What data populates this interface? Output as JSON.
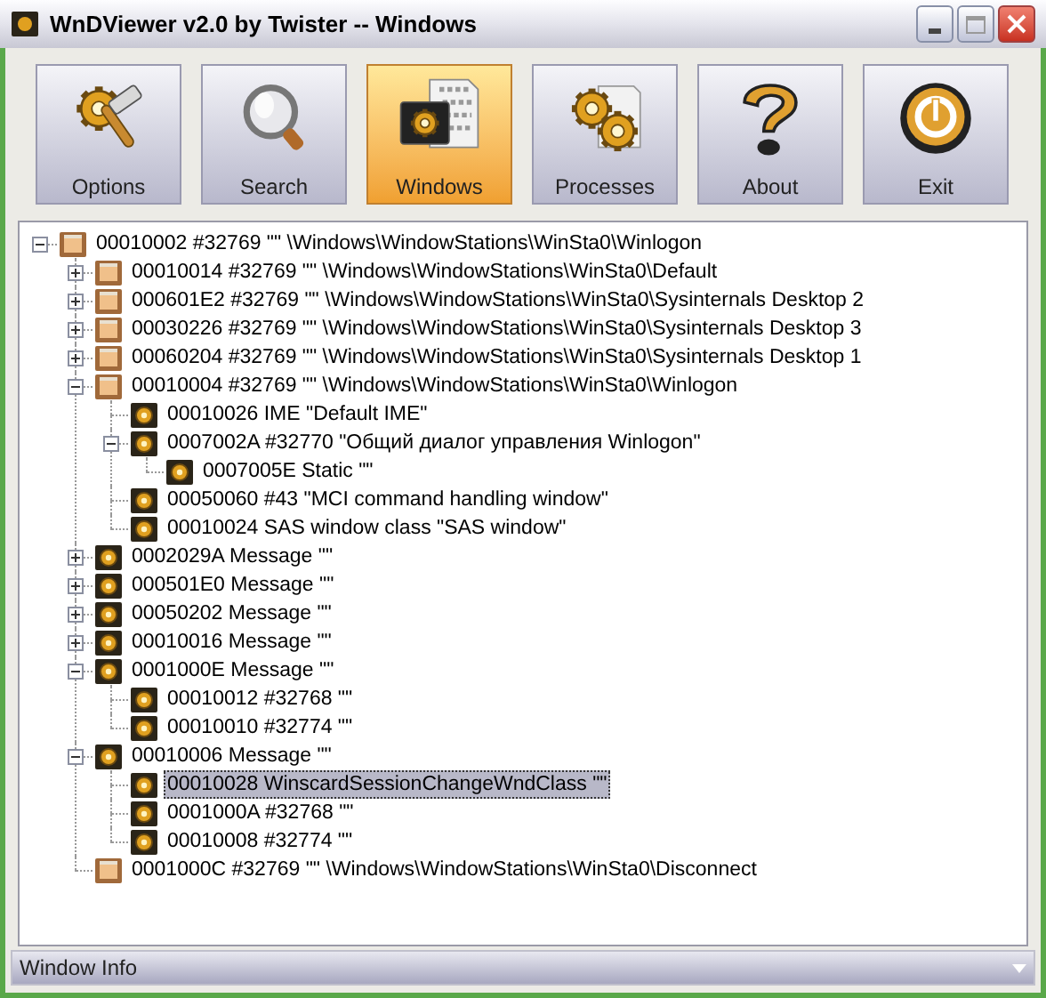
{
  "window": {
    "title": "WnDViewer v2.0 by Twister -- Windows"
  },
  "toolbar": [
    {
      "label": "Options",
      "kind": "options",
      "selected": false
    },
    {
      "label": "Search",
      "kind": "search",
      "selected": false
    },
    {
      "label": "Windows",
      "kind": "windows",
      "selected": true
    },
    {
      "label": "Processes",
      "kind": "processes",
      "selected": false
    },
    {
      "label": "About",
      "kind": "about",
      "selected": false
    },
    {
      "label": "Exit",
      "kind": "exit",
      "selected": false
    }
  ],
  "tree": [
    {
      "text": "00010002 #32769 \"\" \\Windows\\WindowStations\\WinSta0\\Winlogon",
      "kind": "desktop",
      "selected": false,
      "expanded": true,
      "children": [
        {
          "text": "00010014 #32769 \"\" \\Windows\\WindowStations\\WinSta0\\Default",
          "kind": "desktop",
          "selected": false,
          "expanded": false
        },
        {
          "text": "000601E2 #32769 \"\" \\Windows\\WindowStations\\WinSta0\\Sysinternals Desktop 2",
          "kind": "desktop",
          "selected": false,
          "expanded": false
        },
        {
          "text": "00030226 #32769 \"\" \\Windows\\WindowStations\\WinSta0\\Sysinternals Desktop 3",
          "kind": "desktop",
          "selected": false,
          "expanded": false
        },
        {
          "text": "00060204 #32769 \"\" \\Windows\\WindowStations\\WinSta0\\Sysinternals Desktop 1",
          "kind": "desktop",
          "selected": false,
          "expanded": false
        },
        {
          "text": "00010004 #32769 \"\" \\Windows\\WindowStations\\WinSta0\\Winlogon",
          "kind": "desktop",
          "selected": false,
          "expanded": true,
          "children": [
            {
              "text": "00010026 IME \"Default IME\"",
              "kind": "window",
              "selected": false
            },
            {
              "text": "0007002A #32770 \"Общий диалог управления Winlogon\"",
              "kind": "window",
              "selected": false,
              "expanded": true,
              "children": [
                {
                  "text": "0007005E Static \"\"",
                  "kind": "window",
                  "selected": false
                }
              ]
            },
            {
              "text": "00050060 #43 \"MCI command handling window\"",
              "kind": "window",
              "selected": false
            },
            {
              "text": "00010024 SAS window class \"SAS window\"",
              "kind": "window",
              "selected": false
            }
          ]
        },
        {
          "text": "0002029A Message \"\"",
          "kind": "window",
          "selected": false,
          "expanded": false
        },
        {
          "text": "000501E0 Message \"\"",
          "kind": "window",
          "selected": false,
          "expanded": false
        },
        {
          "text": "00050202 Message \"\"",
          "kind": "window",
          "selected": false,
          "expanded": false
        },
        {
          "text": "00010016 Message \"\"",
          "kind": "window",
          "selected": false,
          "expanded": false
        },
        {
          "text": "0001000E Message \"\"",
          "kind": "window",
          "selected": false,
          "expanded": true,
          "children": [
            {
              "text": "00010012 #32768 \"\"",
              "kind": "window",
              "selected": false
            },
            {
              "text": "00010010 #32774 \"\"",
              "kind": "window",
              "selected": false
            }
          ]
        },
        {
          "text": "00010006 Message \"\"",
          "kind": "window",
          "selected": false,
          "expanded": true,
          "children": [
            {
              "text": "00010028 WinscardSessionChangeWndClass \"\"",
              "kind": "window",
              "selected": true
            },
            {
              "text": "0001000A #32768 \"\"",
              "kind": "window",
              "selected": false
            },
            {
              "text": "00010008 #32774 \"\"",
              "kind": "window",
              "selected": false
            }
          ]
        },
        {
          "text": "0001000C #32769 \"\" \\Windows\\WindowStations\\WinSta0\\Disconnect",
          "kind": "desktop",
          "selected": false
        }
      ]
    }
  ],
  "status_bar": {
    "text": "Window Info"
  }
}
